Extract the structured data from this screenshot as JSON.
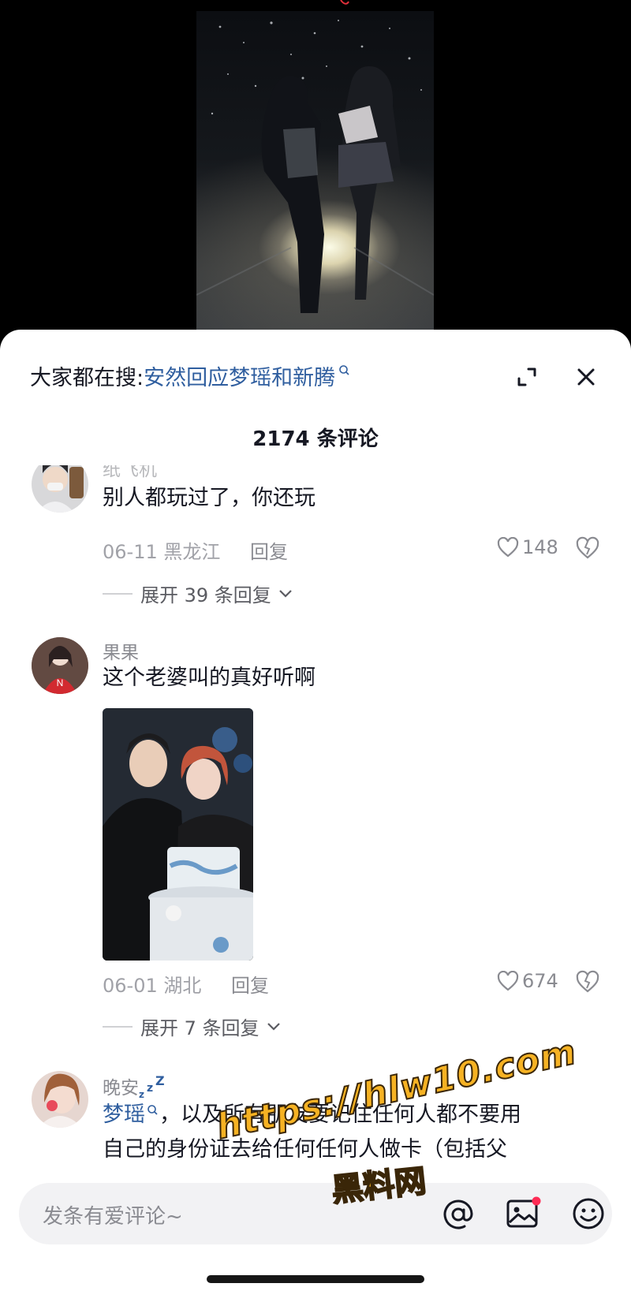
{
  "search": {
    "prefix": "大家都在搜:",
    "query": "安然回应梦瑶和新腾"
  },
  "comment_count_label": "2174 条评论",
  "comments": [
    {
      "username": "纸飞机",
      "text": "别人都玩过了，你还玩",
      "date": "06-11",
      "location": "黑龙江",
      "reply_label": "回复",
      "likes": "148",
      "expand_label": "展开 39 条回复"
    },
    {
      "username": "果果",
      "text": "这个老婆叫的真好听啊",
      "date": "06-01",
      "location": "湖北",
      "reply_label": "回复",
      "likes": "674",
      "expand_label": "展开 7 条回复"
    },
    {
      "username": "晚安",
      "mention": "梦瑶",
      "text_line1": "，以及所有朋友要记住任何人都不要用",
      "text_line2": "自己的身份证去给任何任何人做卡（包括父"
    }
  ],
  "input": {
    "placeholder": "发条有爱评论~"
  },
  "watermark": {
    "url": "https://hlw10.com",
    "name": "黑料网"
  },
  "colors": {
    "link": "#2f5e9f",
    "notification_dot": "#fe2c55",
    "watermark": "#f6b223"
  }
}
